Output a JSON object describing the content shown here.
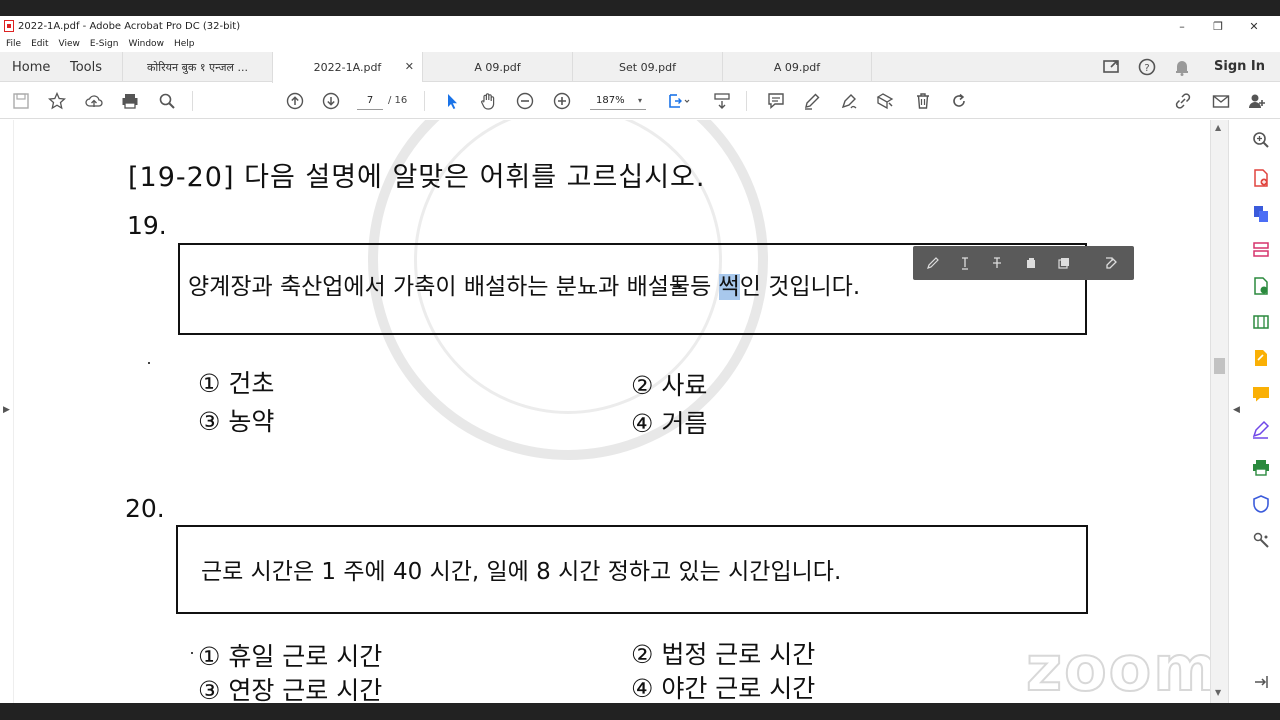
{
  "window": {
    "title": "2022-1A.pdf - Adobe Acrobat Pro DC (32-bit)",
    "min": "–",
    "max": "❐",
    "close": "✕"
  },
  "menu": [
    "File",
    "Edit",
    "View",
    "E-Sign",
    "Window",
    "Help"
  ],
  "tabs": {
    "home": "Home",
    "tools": "Tools",
    "docs": [
      {
        "label": "कोरियन बुक १ एन्जल ...",
        "active": false
      },
      {
        "label": "2022-1A.pdf",
        "active": true
      },
      {
        "label": "A 09.pdf",
        "active": false
      },
      {
        "label": "Set 09.pdf",
        "active": false
      },
      {
        "label": "A 09.pdf",
        "active": false
      }
    ],
    "close_symbol": "✕",
    "sign_in": "Sign In"
  },
  "toolbar": {
    "current_page": "7",
    "total_pages": "/ 16",
    "zoom": "187%",
    "zoom_caret": "▾"
  },
  "document": {
    "heading": "[19-20] 다음 설명에 알맞은 어휘를 고르십시오.",
    "q19": {
      "number": "19.",
      "text_before": "양계장과 축산업에서 가축이 배설하는 분뇨과 배설물등 ",
      "text_highlight": "썩",
      "text_after": "인 것입니다.",
      "options": [
        "① 건초",
        "② 사료",
        "③ 농약",
        "④ 거름"
      ]
    },
    "q20": {
      "number": "20.",
      "text": "근로 시간은 1 주에 40 시간, 일에 8 시간 정하고 있는 시간입니다.",
      "options": [
        "① 휴일 근로 시간",
        "② 법정 근로 시간",
        "③ 연장 근로 시간",
        "④ 야간 근로 시간"
      ]
    },
    "overlay_logo": "zoom"
  },
  "colors": {
    "highlight": "#a8c8ec",
    "accent_blue": "#1a73e8"
  }
}
